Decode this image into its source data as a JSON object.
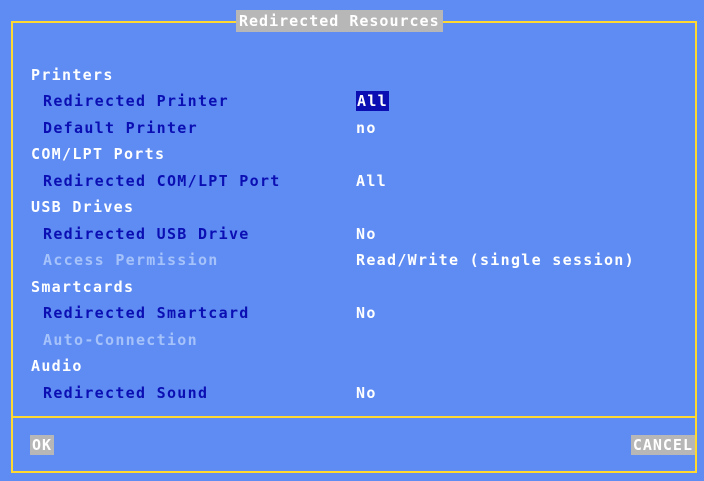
{
  "dialog": {
    "title": "Redirected Resources",
    "sections": {
      "printers": {
        "label": "Printers",
        "redirected_printer": {
          "label": "Redirected Printer",
          "value": "All"
        },
        "default_printer": {
          "label": "Default Printer",
          "value": "no"
        }
      },
      "com_lpt": {
        "label": "COM/LPT Ports",
        "redirected_port": {
          "label": "Redirected COM/LPT Port",
          "value": "All"
        }
      },
      "usb": {
        "label": "USB Drives",
        "redirected_drive": {
          "label": "Redirected USB Drive",
          "value": "No"
        },
        "access_permission": {
          "label": "Access Permission",
          "value": "Read/Write (single session)"
        }
      },
      "smartcards": {
        "label": "Smartcards",
        "redirected_smartcard": {
          "label": "Redirected Smartcard",
          "value": "No"
        },
        "auto_connection": {
          "label": "Auto-Connection"
        }
      },
      "audio": {
        "label": "Audio",
        "redirected_sound": {
          "label": "Redirected Sound",
          "value": "No"
        }
      }
    },
    "buttons": {
      "ok": "OK",
      "cancel": "CANCEL"
    }
  },
  "colors": {
    "background": "#5e8cf2",
    "border": "#ffd830",
    "label_text": "#0b0fb3",
    "disabled_text": "#a6c2fb",
    "value_text": "#ffffff",
    "selection": "#0b0fb3",
    "button": "#b7b7b7"
  }
}
